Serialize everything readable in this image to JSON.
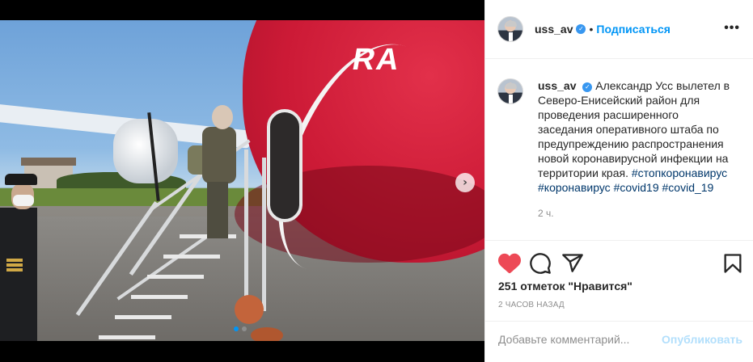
{
  "post": {
    "username": "uss_av",
    "verified_glyph": "✓",
    "separator": "•",
    "follow_label": "Подписаться",
    "more_glyph": "•••",
    "caption_username": "uss_av",
    "caption_text": "Александр Усс вылетел в Северо-Енисейский район для проведения расширенного заседания оперативного штаба по предупреждению распространения новой коронавирусной инфекции на территории края.",
    "hashtags": [
      "#стопкоронавирус",
      "#коронавирус",
      "#covid19",
      "#covid_19"
    ],
    "caption_time": "2 ч.",
    "likes_text": "251 отметок \"Нравится\"",
    "posted_ago": "2 ЧАСОВ НАЗАД",
    "comment_placeholder": "Добавьте комментарий...",
    "publish_label": "Опубликовать"
  },
  "media": {
    "aircraft_text": "RA",
    "next_glyph": "›",
    "slides": 2,
    "active_slide": 1
  },
  "colors": {
    "like": "#ed4956",
    "link": "#0095f6",
    "hashtag": "#00376b",
    "publish_disabled": "#b2dffc"
  },
  "icons": [
    "heart-icon",
    "comment-icon",
    "share-icon",
    "bookmark-icon",
    "verified-badge-icon",
    "more-options-icon",
    "next-arrow-icon"
  ]
}
